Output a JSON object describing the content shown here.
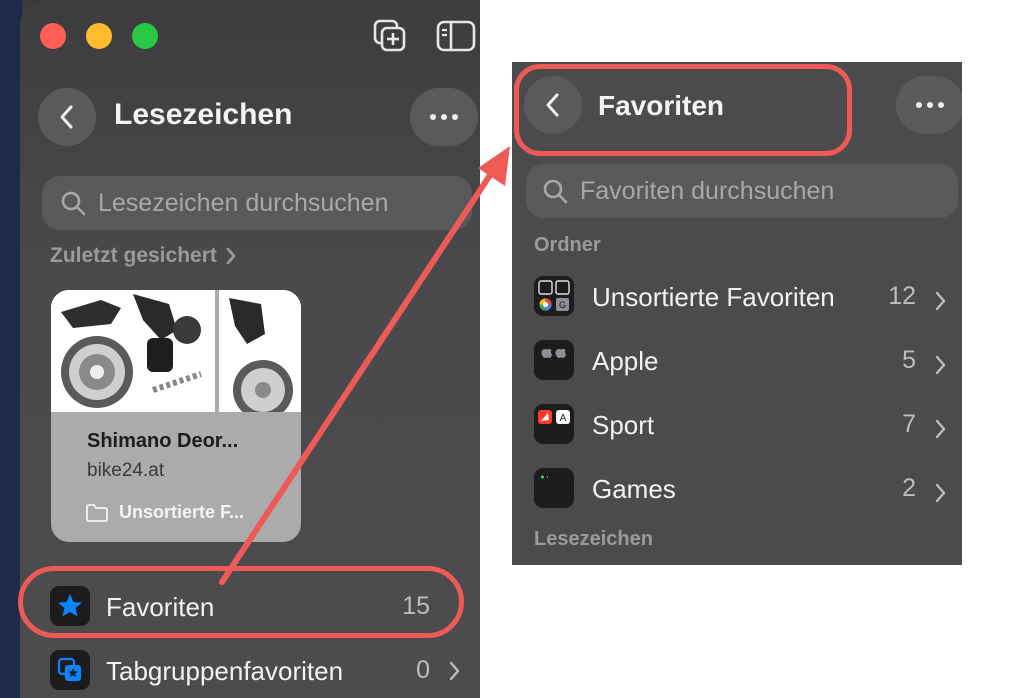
{
  "left": {
    "header_title": "Lesezeichen",
    "search_placeholder": "Lesezeichen durchsuchen",
    "recent_heading": "Zuletzt gesichert",
    "card": {
      "title": "Shimano Deor...",
      "domain": "bike24.at",
      "folder": "Unsortierte F..."
    },
    "rows": [
      {
        "label": "Favoriten",
        "count": "15"
      },
      {
        "label": "Tabgruppenfavoriten",
        "count": "0"
      }
    ]
  },
  "right": {
    "header_title": "Favoriten",
    "search_placeholder": "Favoriten durchsuchen",
    "section_folders": "Ordner",
    "folders": [
      {
        "label": "Unsortierte Favoriten",
        "count": "12"
      },
      {
        "label": "Apple",
        "count": "5"
      },
      {
        "label": "Sport",
        "count": "7"
      },
      {
        "label": "Games",
        "count": "2"
      }
    ],
    "section_bookmarks": "Lesezeichen"
  },
  "icons": {
    "folder_thumb_letters": [
      "G",
      "A"
    ]
  },
  "colors": {
    "accent_blue": "#0a84ff",
    "annotation_red": "#ee5a55",
    "close": "#ff5f57",
    "minimize": "#febc2e",
    "zoom": "#28c840"
  }
}
